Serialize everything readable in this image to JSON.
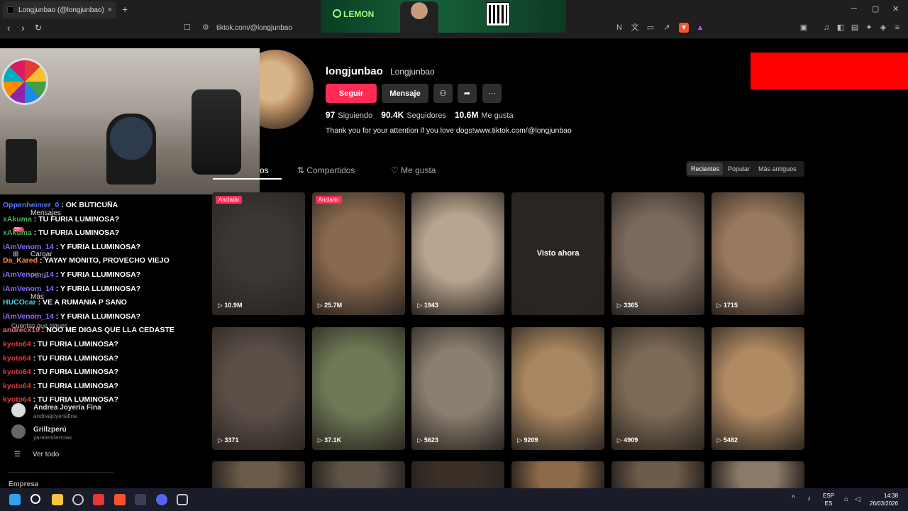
{
  "browser": {
    "tab_title": "Longjunbao (@longjunbao) | Tik",
    "tab_close": "×",
    "new_tab": "+",
    "url": "tiktok.com/@longjunbao"
  },
  "window": {
    "min": "─",
    "max": "▢",
    "close": "✕"
  },
  "ad": {
    "brand": "LEMON"
  },
  "profile": {
    "username": "longjunbao",
    "nickname": "Longjunbao",
    "follow_label": "Seguir",
    "message_label": "Mensaje",
    "more_label": "···",
    "stats": [
      {
        "value": "97",
        "label": "Siguiendo"
      },
      {
        "value": "90.4K",
        "label": "Seguidores"
      },
      {
        "value": "10.6M",
        "label": "Me gusta"
      }
    ],
    "bio": "Thank you for your attention if you love dogs!www.tiktok.com/@longjunbao"
  },
  "tabs": [
    {
      "label": "os"
    },
    {
      "label": "Compartidos"
    },
    {
      "label": "Me gusta"
    }
  ],
  "sort": {
    "options": [
      "Recientes",
      "Popular",
      "Más antiguos"
    ],
    "active": "Recientes"
  },
  "videos": [
    {
      "views": "10.9M",
      "badge": "Anclado",
      "color": "#3a3634"
    },
    {
      "views": "25.7M",
      "badge": "Anclado",
      "color": "#8a6a4e"
    },
    {
      "views": "1943",
      "color": "#b9a58f"
    },
    {
      "views": "",
      "overlay": "Visto ahora",
      "color": "#2a2622"
    },
    {
      "views": "3365",
      "color": "#7a6a5c"
    },
    {
      "views": "1715",
      "color": "#9a7a5e"
    },
    {
      "views": "3371",
      "color": "#5b5048"
    },
    {
      "views": "37.1K",
      "color": "#6e7a55"
    },
    {
      "views": "5623",
      "color": "#8a7f70"
    },
    {
      "views": "9209",
      "color": "#a88660"
    },
    {
      "views": "4909",
      "color": "#7d6a55"
    },
    {
      "views": "5482",
      "color": "#b08a62"
    },
    {
      "views": "",
      "color": "#6a5a48"
    },
    {
      "views": "",
      "color": "#5e5448"
    },
    {
      "views": "",
      "color": "#3a3028"
    },
    {
      "views": "",
      "color": "#8e6a4a"
    },
    {
      "views": "",
      "color": "#6e5c4a"
    },
    {
      "views": "",
      "color": "#8a7a68"
    }
  ],
  "chat": [
    {
      "user": "Oppenheimer_0",
      "msg": " : OK BUTICUÑA",
      "color": "#5b7bff"
    },
    {
      "user": "xAkuma",
      "msg": " : TU FURIA LUMINOSA?",
      "color": "#4caf50"
    },
    {
      "user": "xAkuma",
      "msg": " : TU FURIA LUMINOSA?",
      "color": "#4caf50"
    },
    {
      "user": "iAmVenom_14",
      "msg": " : Y FURIA LLUMINOSA?",
      "color": "#8e6bff"
    },
    {
      "user": "Da_Kared",
      "msg": " : YAYAY MONITO, PROVECHO VIEJO",
      "color": "#ff8a3d"
    },
    {
      "user": "iAmVenom_14",
      "msg": " : Y FURIA LLUMINOSA?",
      "color": "#8e6bff"
    },
    {
      "user": "iAmVenom_14",
      "msg": " : Y FURIA LLUMINOSA?",
      "color": "#8e6bff"
    },
    {
      "user": "HUCOcar",
      "msg": " : VE A RUMANIA P SANO",
      "color": "#4dd0e1"
    },
    {
      "user": "iAmVenom_14",
      "msg": " : Y FURIA LLUMINOSA?",
      "color": "#8e6bff"
    },
    {
      "user": "andrecx19",
      "msg": " : NOO ME DIGAS QUE LLA CEDASTE",
      "color": "#e57373"
    },
    {
      "user": "kyoto64",
      "msg": " : TU FURIA LUMINOSA?",
      "color": "#e53935"
    },
    {
      "user": "kyoto64",
      "msg": " : TU FURIA LUMINOSA?",
      "color": "#e53935"
    },
    {
      "user": "kyoto64",
      "msg": " : TU FURIA LUMINOSA?",
      "color": "#e53935"
    },
    {
      "user": "kyoto64",
      "msg": " : TU FURIA LUMINOSA?",
      "color": "#e53935"
    },
    {
      "user": "kyoto64",
      "msg": " : TU FURIA LUMINOSA?",
      "color": "#e53935"
    }
  ],
  "sidebar": {
    "mensajes": "Mensajes",
    "cargar": "Cargar",
    "perfil": "Perfil",
    "mas": "Más",
    "following_title": "Cuentas que sigues",
    "accounts": [
      {
        "name": "Andrea Joyería Fina",
        "handle": "andreajoyeriafina"
      },
      {
        "name": "Grillzperú",
        "handle": "yaratendencias"
      }
    ],
    "see_all": "Ver todo",
    "company": "Empresa",
    "badge": "99+"
  },
  "taskbar": {
    "lang": "ESP",
    "lang2": "ES",
    "time": "14:38",
    "date": "26/03/2026"
  }
}
